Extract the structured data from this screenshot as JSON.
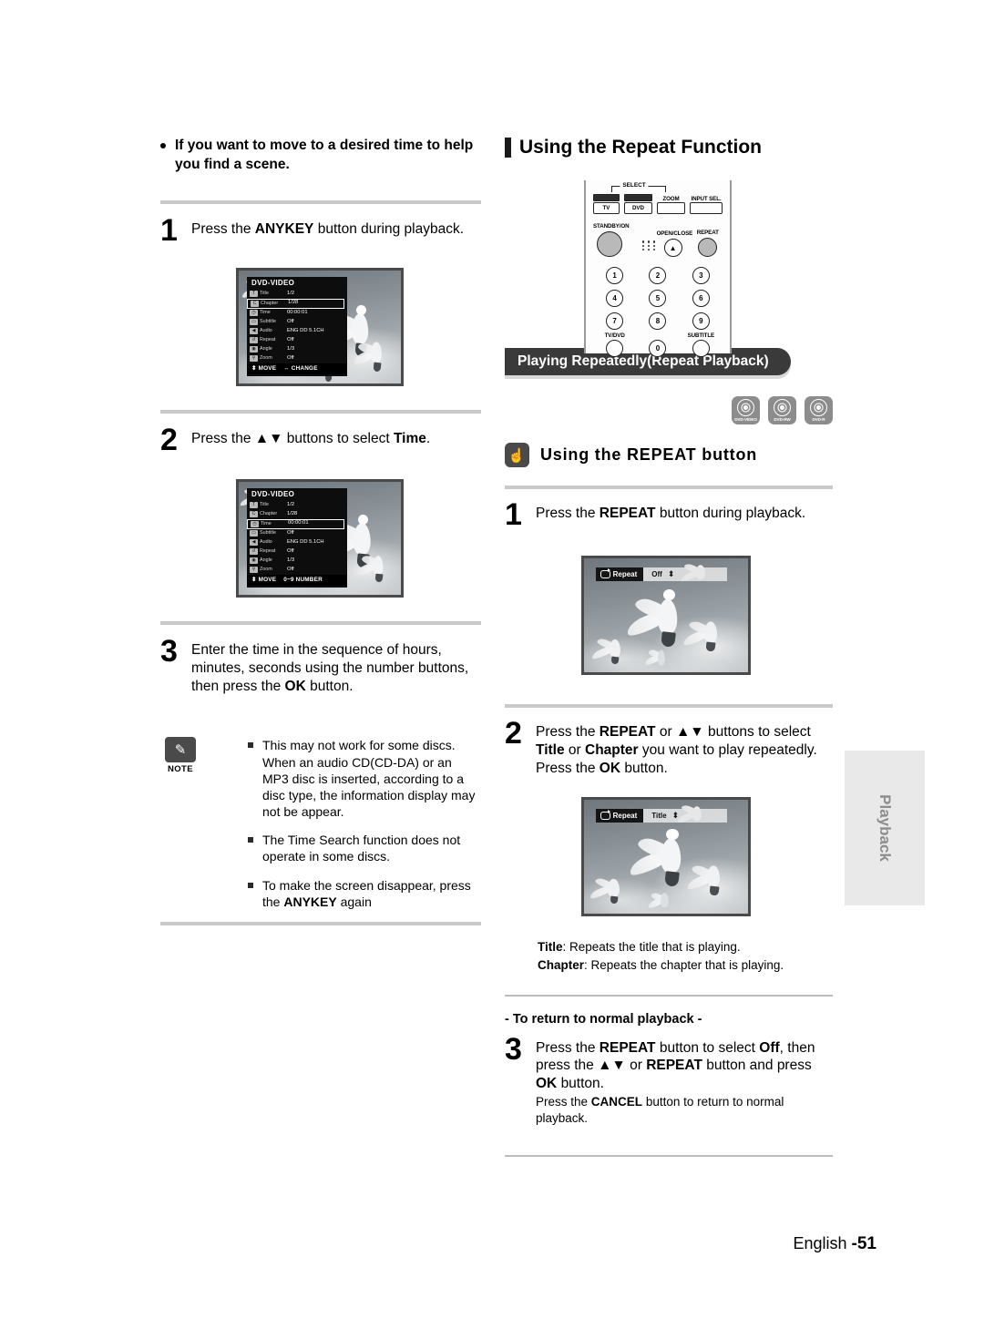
{
  "page": {
    "language": "English",
    "number": "-51",
    "side_tab": "Playback"
  },
  "left_column": {
    "intro_bullet": "If you want to move to a desired time to help you find a scene.",
    "steps": [
      {
        "num": "1",
        "text_parts": [
          "Press the ",
          "ANYKEY",
          " button during playback."
        ]
      },
      {
        "num": "2",
        "text_parts": [
          "Press the ",
          "▲▼",
          " buttons to select ",
          "Time",
          "."
        ]
      },
      {
        "num": "3",
        "text_parts": [
          "Enter the time in the sequence of hours, minutes, seconds using the number buttons, then press the ",
          "OK",
          " button."
        ]
      }
    ],
    "step1_label": "Press the",
    "step1_bold": "ANYKEY",
    "step1_tail": "button during playback.",
    "step2_label": "Press the",
    "step2_arrows": "▲▼",
    "step2_mid": "buttons to select",
    "step2_bold": "Time",
    "step2_tail": ".",
    "step3_a": "Enter the time in the sequence of hours, minutes, seconds using the number",
    "step3_b": "buttons, then press the",
    "step3_bold": "OK",
    "step3_tail": "button.",
    "osd_1": {
      "header": "DVD-VIDEO",
      "rows": [
        {
          "label": "Title",
          "value": "1/2",
          "icon": "title-icon",
          "selected": false
        },
        {
          "label": "Chapter",
          "value": "1/28",
          "icon": "chapter-icon",
          "selected": true
        },
        {
          "label": "Time",
          "value": "00:00:01",
          "icon": "clock-icon",
          "selected": false
        },
        {
          "label": "Subtitle",
          "value": "Off",
          "icon": "subtitle-icon",
          "selected": false
        },
        {
          "label": "Audio",
          "value": "ENG DD 5.1CH",
          "icon": "audio-icon",
          "selected": false
        },
        {
          "label": "Repeat",
          "value": "Off",
          "icon": "repeat-icon",
          "selected": false
        },
        {
          "label": "Angle",
          "value": "1/3",
          "icon": "angle-icon",
          "selected": false
        },
        {
          "label": "Zoom",
          "value": "Off",
          "icon": "zoom-icon",
          "selected": false
        }
      ],
      "footer_move": "MOVE",
      "footer_action": "CHANGE",
      "footer_move_key": "⬍",
      "footer_action_key": "↔"
    },
    "osd_2": {
      "header": "DVD-VIDEO",
      "rows": [
        {
          "label": "Title",
          "value": "1/2",
          "icon": "title-icon",
          "selected": false
        },
        {
          "label": "Chapter",
          "value": "1/28",
          "icon": "chapter-icon",
          "selected": false
        },
        {
          "label": "Time",
          "value": "00:00:01",
          "icon": "clock-icon",
          "selected": true
        },
        {
          "label": "Subtitle",
          "value": "Off",
          "icon": "subtitle-icon",
          "selected": false
        },
        {
          "label": "Audio",
          "value": "ENG DD 5.1CH",
          "icon": "audio-icon",
          "selected": false
        },
        {
          "label": "Repeat",
          "value": "Off",
          "icon": "repeat-icon",
          "selected": false
        },
        {
          "label": "Angle",
          "value": "1/3",
          "icon": "angle-icon",
          "selected": false
        },
        {
          "label": "Zoom",
          "value": "Off",
          "icon": "zoom-icon",
          "selected": false
        }
      ],
      "footer_move": "MOVE",
      "footer_action": "NUMBER",
      "footer_move_key": "⬍",
      "footer_action_key": "0~9"
    },
    "note": {
      "label": "NOTE",
      "icon": "pencil-icon",
      "items": [
        "This may not work for some discs. When an audio CD(CD-DA) or an MP3 disc is inserted, according to a disc type, the information display may not be appear.",
        "The Time Search function does not operate in some discs.",
        "To make the screen disappear, press the ANYKEY again"
      ],
      "item3_pre": "To make the screen disappear, press the",
      "item3_bold": "ANYKEY",
      "item3_tail": "again"
    }
  },
  "right_column": {
    "heading": "Using the Repeat Function",
    "banner": "Playing Repeatedly(Repeat Playback)",
    "discs": [
      {
        "label": "DVD-VIDEO",
        "icon": "disc-icon"
      },
      {
        "label": "DVD-RW",
        "icon": "disc-icon"
      },
      {
        "label": "DVD-R",
        "icon": "disc-icon"
      }
    ],
    "subheading": "Using the REPEAT button",
    "subheading_icon": "hand-press-icon",
    "step1": {
      "num": "1",
      "pre": "Press the",
      "bold": "REPEAT",
      "tail": "button during playback."
    },
    "step2": {
      "num": "2",
      "line1_pre": "Press the",
      "line1_b1": "REPEAT",
      "line1_mid": "or",
      "line1_arrows": "▲▼",
      "line1_tail": "buttons to select",
      "line2_b1": "Title",
      "line2_mid": "or",
      "line2_b2": "Chapter",
      "line2_tail": "you want to play repeatedly.",
      "line3_pre": "Press the",
      "line3_bold": "OK",
      "line3_tail": "button."
    },
    "definitions": [
      {
        "term": "Title",
        "text": ": Repeats the title that is playing."
      },
      {
        "term": "Chapter",
        "text": ": Repeats the chapter that is playing."
      }
    ],
    "return_heading": "- To return to normal playback -",
    "step3": {
      "num": "3",
      "line1_pre": "Press the",
      "line1_b1": "REPEAT",
      "line1_mid": "button to select",
      "line1_b2": "Off",
      "line1_tail": ",",
      "line2_pre": "then press the",
      "line2_arrows": "▲▼",
      "line2_mid": "or",
      "line2_b1": "REPEAT",
      "line2_tail": "button and",
      "line3_pre": "press",
      "line3_b1": "OK",
      "line3_tail": "button.",
      "line4_pre": "Press the",
      "line4_b1": "CANCEL",
      "line4_tail": "button to return to normal playback."
    },
    "repeat_bar_1": {
      "tag": "Repeat",
      "value": "Off",
      "stepper": "⬍",
      "icon": "repeat-loop-icon"
    },
    "repeat_bar_2": {
      "tag": "Repeat",
      "value": "Title",
      "stepper": "⬍",
      "icon": "repeat-loop-icon"
    }
  },
  "remote": {
    "select_label": "SELECT",
    "tv_button": "TV",
    "dvd_button": "DVD",
    "zoom_label": "ZOOM",
    "input_sel_label": "INPUT SEL.",
    "standby_label": "STANDBY/ON",
    "open_close_label": "OPEN/CLOSE",
    "repeat_label": "REPEAT",
    "open_close_glyph": "▲",
    "keys": [
      "1",
      "2",
      "3",
      "4",
      "5",
      "6",
      "7",
      "8",
      "9"
    ],
    "zero_key": "0",
    "tv_dvd_label": "TV/DVD",
    "subtitle_label": "SUBTITLE"
  },
  "colors": {
    "rule": "#c9c9c9",
    "banner_bg": "#3a3a3a",
    "badge_bg": "#4a4a4a",
    "disc_bg": "#8c8c8c",
    "sidetab_bg": "#e9e9e9",
    "sidetab_text": "#8d8d8d"
  }
}
